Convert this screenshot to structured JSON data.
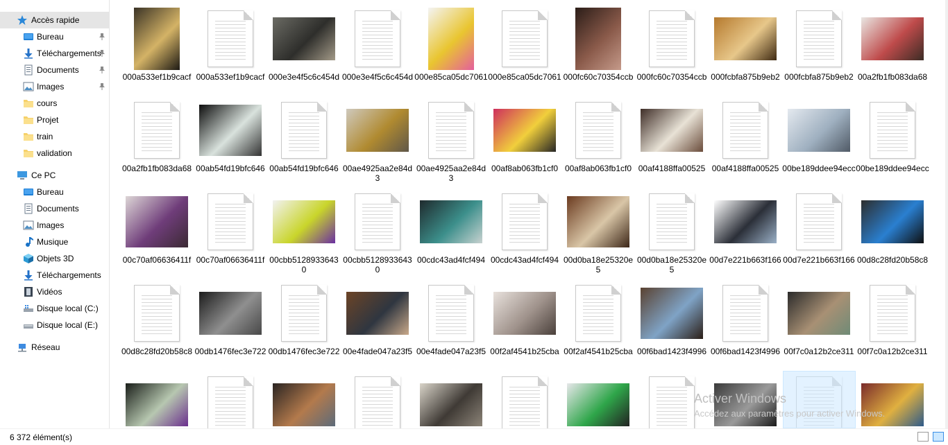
{
  "sidebar": {
    "quick_access": "Accès rapide",
    "quick_items": [
      {
        "label": "Bureau",
        "icon": "desktop-folder-icon",
        "pinned": true
      },
      {
        "label": "Téléchargements",
        "icon": "download-arrow-icon",
        "pinned": true
      },
      {
        "label": "Documents",
        "icon": "documents-folder-icon",
        "pinned": true
      },
      {
        "label": "Images",
        "icon": "pictures-folder-icon",
        "pinned": true
      },
      {
        "label": "cours",
        "icon": "folder-icon",
        "pinned": false
      },
      {
        "label": "Projet",
        "icon": "folder-icon",
        "pinned": false
      },
      {
        "label": "train",
        "icon": "folder-icon",
        "pinned": false
      },
      {
        "label": "validation",
        "icon": "folder-icon",
        "pinned": false
      }
    ],
    "this_pc": "Ce PC",
    "pc_items": [
      {
        "label": "Bureau",
        "icon": "desktop-folder-icon"
      },
      {
        "label": "Documents",
        "icon": "documents-folder-icon"
      },
      {
        "label": "Images",
        "icon": "pictures-folder-icon"
      },
      {
        "label": "Musique",
        "icon": "music-note-icon"
      },
      {
        "label": "Objets 3D",
        "icon": "3d-cube-icon"
      },
      {
        "label": "Téléchargements",
        "icon": "download-arrow-icon"
      },
      {
        "label": "Vidéos",
        "icon": "film-strip-icon"
      },
      {
        "label": "Disque local (C:)",
        "icon": "windows-drive-icon"
      },
      {
        "label": "Disque local (E:)",
        "icon": "drive-icon"
      }
    ],
    "network": "Réseau"
  },
  "files": [
    {
      "name": "000a533ef1b9cacf",
      "kind": "photo",
      "shape": "tall",
      "colors": [
        "#3a3326",
        "#d4b366",
        "#1d1a14"
      ]
    },
    {
      "name": "000a533ef1b9cacf",
      "kind": "doc"
    },
    {
      "name": "000e3e4f5c6c454d",
      "kind": "photo",
      "colors": [
        "#6b6b64",
        "#2e2e2b",
        "#a39a88"
      ]
    },
    {
      "name": "000e3e4f5c6c454d",
      "kind": "doc"
    },
    {
      "name": "000e85ca05dc7061",
      "kind": "photo",
      "shape": "tall",
      "colors": [
        "#f4f4f4",
        "#e9c530",
        "#e45f9d"
      ]
    },
    {
      "name": "000e85ca05dc7061",
      "kind": "doc"
    },
    {
      "name": "000fc60c70354ccb",
      "kind": "photo",
      "shape": "tall",
      "colors": [
        "#2b1d18",
        "#8a5a4a",
        "#c59a8a"
      ]
    },
    {
      "name": "000fc60c70354ccb",
      "kind": "doc"
    },
    {
      "name": "000fcbfa875b9eb2",
      "kind": "photo",
      "colors": [
        "#b5792d",
        "#e7c78a",
        "#3f2a12"
      ]
    },
    {
      "name": "000fcbfa875b9eb2",
      "kind": "doc"
    },
    {
      "name": "00a2fb1fb083da68",
      "kind": "photo",
      "colors": [
        "#e9e6e2",
        "#bf4b4b",
        "#3b2c25"
      ]
    },
    {
      "name": "00a2fb1fb083da68",
      "kind": "doc"
    },
    {
      "name": "00ab54fd19bfc646",
      "kind": "photo",
      "shape": "sq",
      "colors": [
        "#0d0d0d",
        "#d9e2dd",
        "#333333"
      ]
    },
    {
      "name": "00ab54fd19bfc646",
      "kind": "doc"
    },
    {
      "name": "00ae4925aa2e84d3",
      "kind": "photo",
      "colors": [
        "#cfc9bd",
        "#b08a30",
        "#5f5749"
      ]
    },
    {
      "name": "00ae4925aa2e84d3",
      "kind": "doc"
    },
    {
      "name": "00af8ab063fb1cf0",
      "kind": "photo",
      "colors": [
        "#ce2f5d",
        "#f1cf3c",
        "#262626"
      ]
    },
    {
      "name": "00af8ab063fb1cf0",
      "kind": "doc"
    },
    {
      "name": "00af4188ffa00525",
      "kind": "photo",
      "colors": [
        "#3f2e28",
        "#e8e2d6",
        "#6a4c3b"
      ]
    },
    {
      "name": "00af4188ffa00525",
      "kind": "doc"
    },
    {
      "name": "00be189ddee94ecc",
      "kind": "photo",
      "colors": [
        "#e4e9ef",
        "#9fb0c0",
        "#505a66"
      ]
    },
    {
      "name": "00be189ddee94ecc",
      "kind": "doc"
    },
    {
      "name": "00c70af06636411f",
      "kind": "photo",
      "shape": "sq",
      "colors": [
        "#ddd6d6",
        "#6f3d7a",
        "#3b2a33"
      ]
    },
    {
      "name": "00c70af06636411f",
      "kind": "doc"
    },
    {
      "name": "00cbb51289336430",
      "kind": "photo",
      "colors": [
        "#f2f2f2",
        "#c9d52b",
        "#6a2fa2"
      ]
    },
    {
      "name": "00cbb51289336430",
      "kind": "doc"
    },
    {
      "name": "00cdc43ad4fcf494",
      "kind": "photo",
      "colors": [
        "#1f2a2d",
        "#3c8f8b",
        "#c8d2d0"
      ]
    },
    {
      "name": "00cdc43ad4fcf494",
      "kind": "doc"
    },
    {
      "name": "00d0ba18e25320e5",
      "kind": "photo",
      "shape": "sq",
      "colors": [
        "#6b3b20",
        "#d9c6a7",
        "#3d2718"
      ]
    },
    {
      "name": "00d0ba18e25320e5",
      "kind": "doc"
    },
    {
      "name": "00d7e221b663f166",
      "kind": "photo",
      "colors": [
        "#ffffff",
        "#2b2f38",
        "#9ab0c7"
      ]
    },
    {
      "name": "00d7e221b663f166",
      "kind": "doc"
    },
    {
      "name": "00d8c28fd20b58c8",
      "kind": "photo",
      "colors": [
        "#2d2d2d",
        "#2a7fd0",
        "#0f0f0f"
      ]
    },
    {
      "name": "00d8c28fd20b58c8",
      "kind": "doc"
    },
    {
      "name": "00db1476fec3e722",
      "kind": "photo",
      "colors": [
        "#1c1c1c",
        "#8f8f8f",
        "#484848"
      ]
    },
    {
      "name": "00db1476fec3e722",
      "kind": "doc"
    },
    {
      "name": "00e4fade047a23f5",
      "kind": "photo",
      "colors": [
        "#6c4426",
        "#2f3640",
        "#c9a98a"
      ]
    },
    {
      "name": "00e4fade047a23f5",
      "kind": "doc"
    },
    {
      "name": "00f2af4541b25cba",
      "kind": "photo",
      "colors": [
        "#e8e1dc",
        "#9f928b",
        "#4a403b"
      ]
    },
    {
      "name": "00f2af4541b25cba",
      "kind": "doc"
    },
    {
      "name": "00f6bad1423f4996",
      "kind": "photo",
      "shape": "sq",
      "colors": [
        "#5a4231",
        "#7fa3c6",
        "#2b1e16"
      ]
    },
    {
      "name": "00f6bad1423f4996",
      "kind": "doc"
    },
    {
      "name": "00f7c0a12b2ce311",
      "kind": "photo",
      "colors": [
        "#2b2b2b",
        "#a89074",
        "#6f8b77"
      ]
    },
    {
      "name": "00f7c0a12b2ce311",
      "kind": "doc"
    },
    {
      "name": "",
      "kind": "photo",
      "colors": [
        "#1a1f1a",
        "#b7c7b0",
        "#6a2f8d"
      ]
    },
    {
      "name": "",
      "kind": "doc"
    },
    {
      "name": "",
      "kind": "photo",
      "colors": [
        "#2a2422",
        "#b37a4c",
        "#5c6b7a"
      ]
    },
    {
      "name": "",
      "kind": "doc"
    },
    {
      "name": "",
      "kind": "photo",
      "colors": [
        "#d9d4c9",
        "#3f3a35",
        "#8c8478"
      ]
    },
    {
      "name": "",
      "kind": "doc"
    },
    {
      "name": "",
      "kind": "photo",
      "colors": [
        "#e7e7ea",
        "#2fa64a",
        "#222222"
      ]
    },
    {
      "name": "",
      "kind": "doc"
    },
    {
      "name": "",
      "kind": "photo",
      "colors": [
        "#3a3a3a",
        "#9a9a9a",
        "#1a1a1a"
      ]
    },
    {
      "name": "",
      "kind": "doc"
    },
    {
      "name": "",
      "kind": "photo",
      "colors": [
        "#7a2b2b",
        "#e0b040",
        "#2d5a8a"
      ]
    }
  ],
  "status": {
    "count_text": "6 372 élément(s)"
  },
  "watermark": {
    "line1": "Activer Windows",
    "line2": "Accédez aux paramètres pour activer Windows."
  }
}
